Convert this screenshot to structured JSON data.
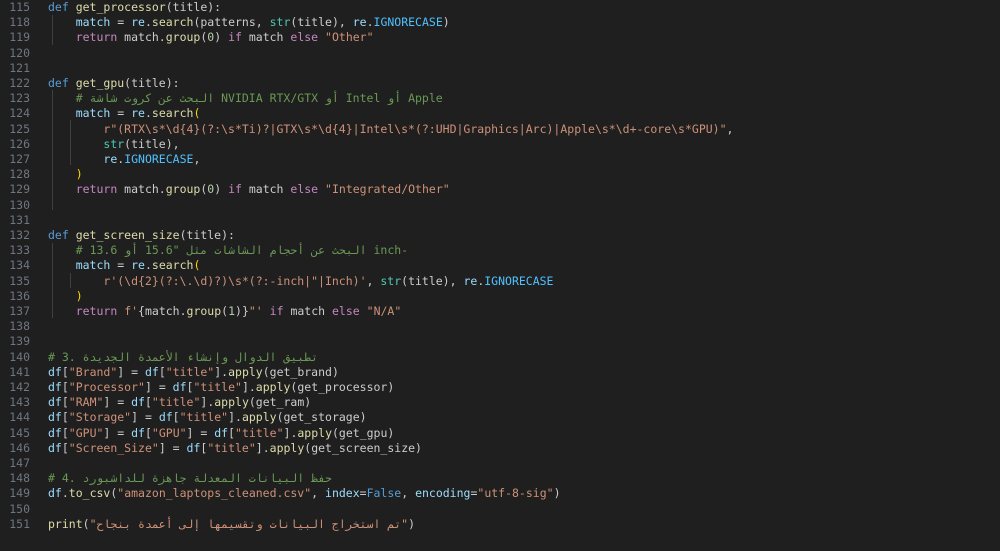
{
  "editor": {
    "language": "python",
    "lines": [
      {
        "n": "115",
        "tokens": [
          [
            "kw",
            "def "
          ],
          [
            "fn",
            "get_processor"
          ],
          [
            "pl",
            "(title):"
          ]
        ]
      },
      {
        "n": "118",
        "tokens": [
          [
            "pl",
            "    "
          ],
          [
            "var",
            "match"
          ],
          [
            "pl",
            " = "
          ],
          [
            "var",
            "re"
          ],
          [
            "pl",
            "."
          ],
          [
            "fn",
            "search"
          ],
          [
            "pl",
            "(patterns, "
          ],
          [
            "bi",
            "str"
          ],
          [
            "pl",
            "(title), "
          ],
          [
            "var",
            "re"
          ],
          [
            "pl",
            "."
          ],
          [
            "cls",
            "IGNORECASE"
          ],
          [
            "pl",
            ")"
          ]
        ]
      },
      {
        "n": "119",
        "tokens": [
          [
            "pl",
            "    "
          ],
          [
            "ctl",
            "return"
          ],
          [
            "pl",
            " match."
          ],
          [
            "fn",
            "group"
          ],
          [
            "pl",
            "("
          ],
          [
            "num",
            "0"
          ],
          [
            "pl",
            ") "
          ],
          [
            "ctl",
            "if"
          ],
          [
            "pl",
            " match "
          ],
          [
            "ctl",
            "else"
          ],
          [
            "pl",
            " "
          ],
          [
            "str",
            "\"Other\""
          ]
        ]
      },
      {
        "n": "120",
        "tokens": []
      },
      {
        "n": "121",
        "tokens": []
      },
      {
        "n": "122",
        "tokens": [
          [
            "kw",
            "def "
          ],
          [
            "fn",
            "get_gpu"
          ],
          [
            "pl",
            "(title):"
          ]
        ]
      },
      {
        "n": "123",
        "tokens": [
          [
            "pl",
            "    "
          ],
          [
            "cmt",
            "# البحث عن كروت شاشة NVIDIA RTX/GTX أو Intel أو Apple"
          ]
        ]
      },
      {
        "n": "124",
        "tokens": [
          [
            "pl",
            "    "
          ],
          [
            "var",
            "match"
          ],
          [
            "pl",
            " = "
          ],
          [
            "var",
            "re"
          ],
          [
            "pl",
            "."
          ],
          [
            "fn",
            "search"
          ],
          [
            "br",
            "("
          ]
        ]
      },
      {
        "n": "125",
        "tokens": [
          [
            "pl",
            "        "
          ],
          [
            "str",
            "r\"(RTX\\s*\\d{4}(?:\\s*Ti)?|GTX\\s*\\d{4}|Intel\\s*(?:UHD|Graphics|Arc)|Apple\\s*\\d+-core\\s*GPU)\""
          ],
          [
            "pl",
            ","
          ]
        ]
      },
      {
        "n": "126",
        "tokens": [
          [
            "pl",
            "        "
          ],
          [
            "bi",
            "str"
          ],
          [
            "pl",
            "(title),"
          ]
        ]
      },
      {
        "n": "127",
        "tokens": [
          [
            "pl",
            "        "
          ],
          [
            "var",
            "re"
          ],
          [
            "pl",
            "."
          ],
          [
            "cls",
            "IGNORECASE"
          ],
          [
            "pl",
            ","
          ]
        ]
      },
      {
        "n": "128",
        "tokens": [
          [
            "pl",
            "    "
          ],
          [
            "br",
            ")"
          ]
        ]
      },
      {
        "n": "129",
        "tokens": [
          [
            "pl",
            "    "
          ],
          [
            "ctl",
            "return"
          ],
          [
            "pl",
            " match."
          ],
          [
            "fn",
            "group"
          ],
          [
            "pl",
            "("
          ],
          [
            "num",
            "0"
          ],
          [
            "pl",
            ") "
          ],
          [
            "ctl",
            "if"
          ],
          [
            "pl",
            " match "
          ],
          [
            "ctl",
            "else"
          ],
          [
            "pl",
            " "
          ],
          [
            "str",
            "\"Integrated/Other\""
          ]
        ]
      },
      {
        "n": "130",
        "tokens": []
      },
      {
        "n": "131",
        "tokens": []
      },
      {
        "n": "132",
        "tokens": [
          [
            "kw",
            "def "
          ],
          [
            "fn",
            "get_screen_size"
          ],
          [
            "pl",
            "(title):"
          ]
        ]
      },
      {
        "n": "133",
        "tokens": [
          [
            "pl",
            "    "
          ],
          [
            "cmt",
            "# البحث عن أحجام الشاشات مثل \"15.6 أو 13.6 inch-"
          ]
        ]
      },
      {
        "n": "134",
        "tokens": [
          [
            "pl",
            "    "
          ],
          [
            "var",
            "match"
          ],
          [
            "pl",
            " = "
          ],
          [
            "var",
            "re"
          ],
          [
            "pl",
            "."
          ],
          [
            "fn",
            "search"
          ],
          [
            "br",
            "("
          ]
        ]
      },
      {
        "n": "135",
        "tokens": [
          [
            "pl",
            "        "
          ],
          [
            "str",
            "r'(\\d{2}(?:\\.\\d)?)\\s*(?:-inch|\"|Inch)'"
          ],
          [
            "pl",
            ", "
          ],
          [
            "bi",
            "str"
          ],
          [
            "pl",
            "(title), "
          ],
          [
            "var",
            "re"
          ],
          [
            "pl",
            "."
          ],
          [
            "cls",
            "IGNORECASE"
          ]
        ]
      },
      {
        "n": "136",
        "tokens": [
          [
            "pl",
            "    "
          ],
          [
            "br",
            ")"
          ]
        ]
      },
      {
        "n": "137",
        "tokens": [
          [
            "pl",
            "    "
          ],
          [
            "ctl",
            "return"
          ],
          [
            "pl",
            " "
          ],
          [
            "str",
            "f'"
          ],
          [
            "pl",
            "{match."
          ],
          [
            "fn",
            "group"
          ],
          [
            "pl",
            "("
          ],
          [
            "num",
            "1"
          ],
          [
            "pl",
            ")}"
          ],
          [
            "str",
            "\"'"
          ],
          [
            "pl",
            " "
          ],
          [
            "ctl",
            "if"
          ],
          [
            "pl",
            " match "
          ],
          [
            "ctl",
            "else"
          ],
          [
            "pl",
            " "
          ],
          [
            "str",
            "\"N/A\""
          ]
        ]
      },
      {
        "n": "138",
        "tokens": []
      },
      {
        "n": "139",
        "tokens": []
      },
      {
        "n": "140",
        "tokens": [
          [
            "cmt",
            "# 3. تطبيق الدوال وإنشاء الأعمدة الجديدة"
          ]
        ]
      },
      {
        "n": "141",
        "tokens": [
          [
            "var",
            "df"
          ],
          [
            "pl",
            "["
          ],
          [
            "str",
            "\"Brand\""
          ],
          [
            "pl",
            "] = "
          ],
          [
            "var",
            "df"
          ],
          [
            "pl",
            "["
          ],
          [
            "str",
            "\"title\""
          ],
          [
            "pl",
            "]."
          ],
          [
            "fn",
            "apply"
          ],
          [
            "pl",
            "(get_brand)"
          ]
        ]
      },
      {
        "n": "142",
        "tokens": [
          [
            "var",
            "df"
          ],
          [
            "pl",
            "["
          ],
          [
            "str",
            "\"Processor\""
          ],
          [
            "pl",
            "] = "
          ],
          [
            "var",
            "df"
          ],
          [
            "pl",
            "["
          ],
          [
            "str",
            "\"title\""
          ],
          [
            "pl",
            "]."
          ],
          [
            "fn",
            "apply"
          ],
          [
            "pl",
            "(get_processor)"
          ]
        ]
      },
      {
        "n": "143",
        "tokens": [
          [
            "var",
            "df"
          ],
          [
            "pl",
            "["
          ],
          [
            "str",
            "\"RAM\""
          ],
          [
            "pl",
            "] = "
          ],
          [
            "var",
            "df"
          ],
          [
            "pl",
            "["
          ],
          [
            "str",
            "\"title\""
          ],
          [
            "pl",
            "]."
          ],
          [
            "fn",
            "apply"
          ],
          [
            "pl",
            "(get_ram)"
          ]
        ]
      },
      {
        "n": "144",
        "tokens": [
          [
            "var",
            "df"
          ],
          [
            "pl",
            "["
          ],
          [
            "str",
            "\"Storage\""
          ],
          [
            "pl",
            "] = "
          ],
          [
            "var",
            "df"
          ],
          [
            "pl",
            "["
          ],
          [
            "str",
            "\"title\""
          ],
          [
            "pl",
            "]."
          ],
          [
            "fn",
            "apply"
          ],
          [
            "pl",
            "(get_storage)"
          ]
        ]
      },
      {
        "n": "145",
        "tokens": [
          [
            "var",
            "df"
          ],
          [
            "pl",
            "["
          ],
          [
            "str",
            "\"GPU\""
          ],
          [
            "pl",
            "] = "
          ],
          [
            "var",
            "df"
          ],
          [
            "pl",
            "["
          ],
          [
            "str",
            "\"GPU\""
          ],
          [
            "pl",
            "] = "
          ],
          [
            "var",
            "df"
          ],
          [
            "pl",
            "["
          ],
          [
            "str",
            "\"title\""
          ],
          [
            "pl",
            "]."
          ],
          [
            "fn",
            "apply"
          ],
          [
            "pl",
            "(get_gpu)"
          ]
        ]
      },
      {
        "n": "146",
        "tokens": [
          [
            "var",
            "df"
          ],
          [
            "pl",
            "["
          ],
          [
            "str",
            "\"Screen_Size\""
          ],
          [
            "pl",
            "] = "
          ],
          [
            "var",
            "df"
          ],
          [
            "pl",
            "["
          ],
          [
            "str",
            "\"title\""
          ],
          [
            "pl",
            "]."
          ],
          [
            "fn",
            "apply"
          ],
          [
            "pl",
            "(get_screen_size)"
          ]
        ]
      },
      {
        "n": "147",
        "tokens": []
      },
      {
        "n": "148",
        "tokens": [
          [
            "cmt",
            "# 4. حفظ البيانات المعدلة جاهزة للداشبورد"
          ]
        ]
      },
      {
        "n": "149",
        "tokens": [
          [
            "var",
            "df"
          ],
          [
            "pl",
            "."
          ],
          [
            "fn",
            "to_csv"
          ],
          [
            "pl",
            "("
          ],
          [
            "str",
            "\"amazon_laptops_cleaned.csv\""
          ],
          [
            "pl",
            ", "
          ],
          [
            "var",
            "index"
          ],
          [
            "pl",
            "="
          ],
          [
            "kw",
            "False"
          ],
          [
            "pl",
            ", "
          ],
          [
            "var",
            "encoding"
          ],
          [
            "pl",
            "="
          ],
          [
            "str",
            "\"utf-8-sig\""
          ],
          [
            "pl",
            ")"
          ]
        ]
      },
      {
        "n": "150",
        "tokens": []
      },
      {
        "n": "151",
        "tokens": [
          [
            "fn",
            "print"
          ],
          [
            "pl",
            "("
          ],
          [
            "str",
            "\"تم استخراج البيانات وتقسيمها إلى أعمدة بنجاح\""
          ],
          [
            "pl",
            ")"
          ]
        ]
      }
    ]
  }
}
